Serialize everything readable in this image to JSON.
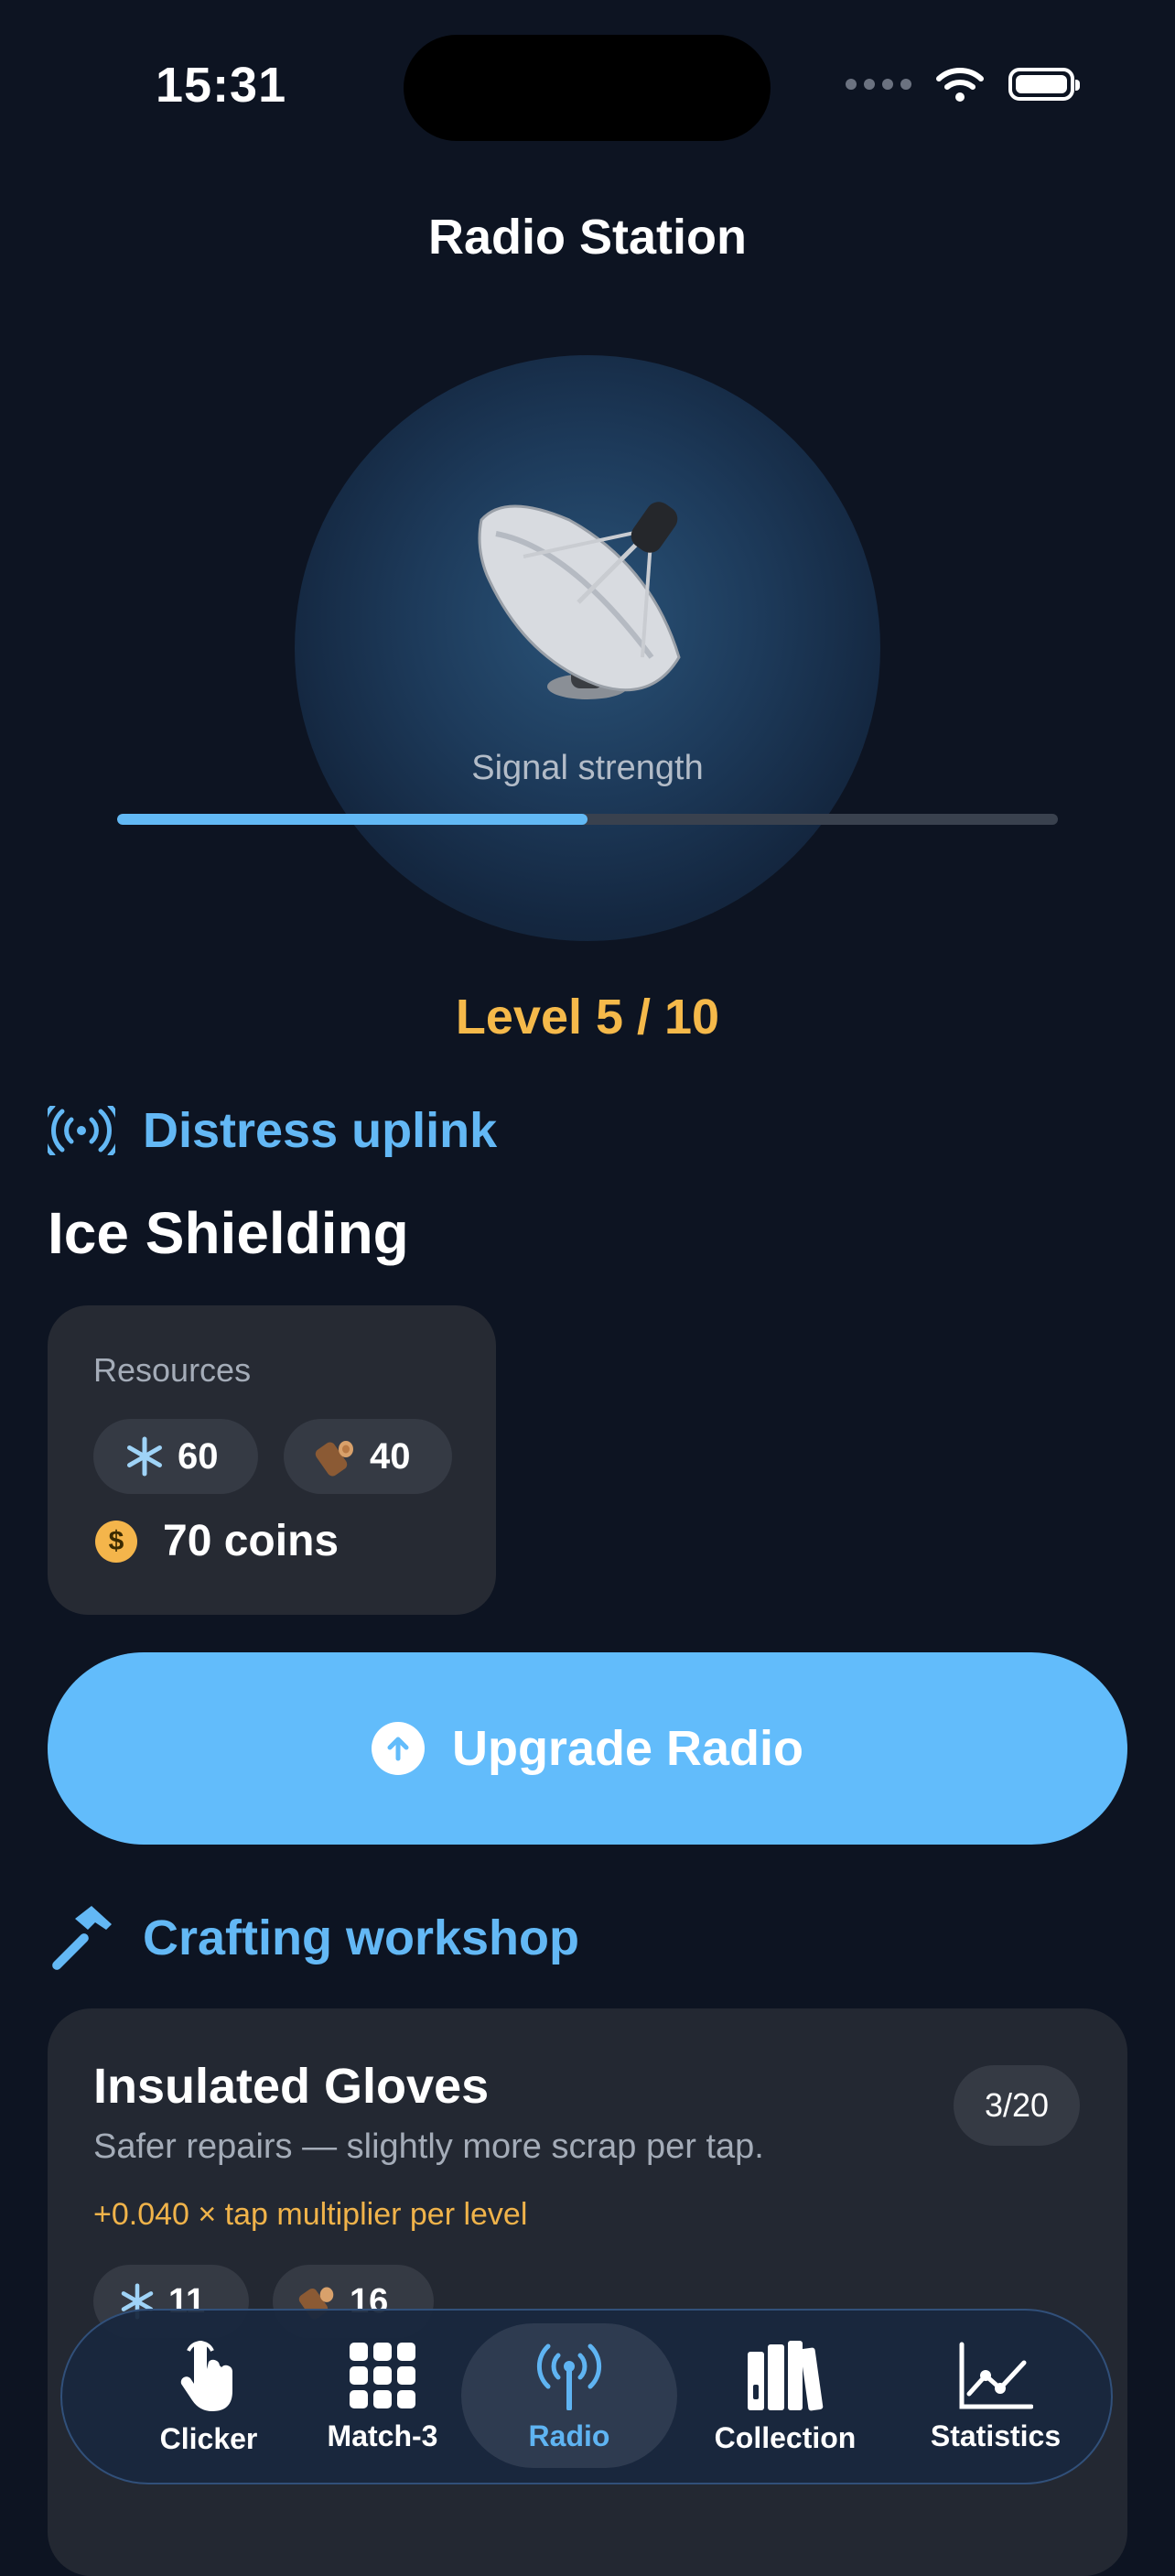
{
  "status_bar": {
    "time": "15:31"
  },
  "header": {
    "title": "Radio Station"
  },
  "hero": {
    "signal_label": "Signal strength",
    "signal_strength": 0.5,
    "level_text": "Level 5 / 10",
    "icon": "satellite-dish-icon"
  },
  "uplink": {
    "section_title": "Distress uplink",
    "upgrade_name": "Ice Shielding",
    "resources_label": "Resources",
    "resource_ice": "60",
    "resource_wood": "40",
    "coins_text": "70 coins",
    "button_label": "Upgrade Radio"
  },
  "workshop": {
    "section_title": "Crafting workshop",
    "item": {
      "title": "Insulated Gloves",
      "description": "Safer repairs — slightly more scrap per tap.",
      "bonus": "+0.040 × tap multiplier per level",
      "level_badge": "3/20",
      "cost_ice": "11",
      "cost_wood": "16"
    }
  },
  "tabbar": {
    "tabs": [
      {
        "label": "Clicker",
        "icon": "hand-tap-icon"
      },
      {
        "label": "Match-3",
        "icon": "grid-icon"
      },
      {
        "label": "Radio",
        "icon": "antenna-icon",
        "active": true
      },
      {
        "label": "Collection",
        "icon": "books-icon"
      },
      {
        "label": "Statistics",
        "icon": "chart-line-icon"
      }
    ]
  },
  "colors": {
    "accent": "#62bcfb",
    "level": "#f5b94a",
    "background": "#0d1422"
  }
}
